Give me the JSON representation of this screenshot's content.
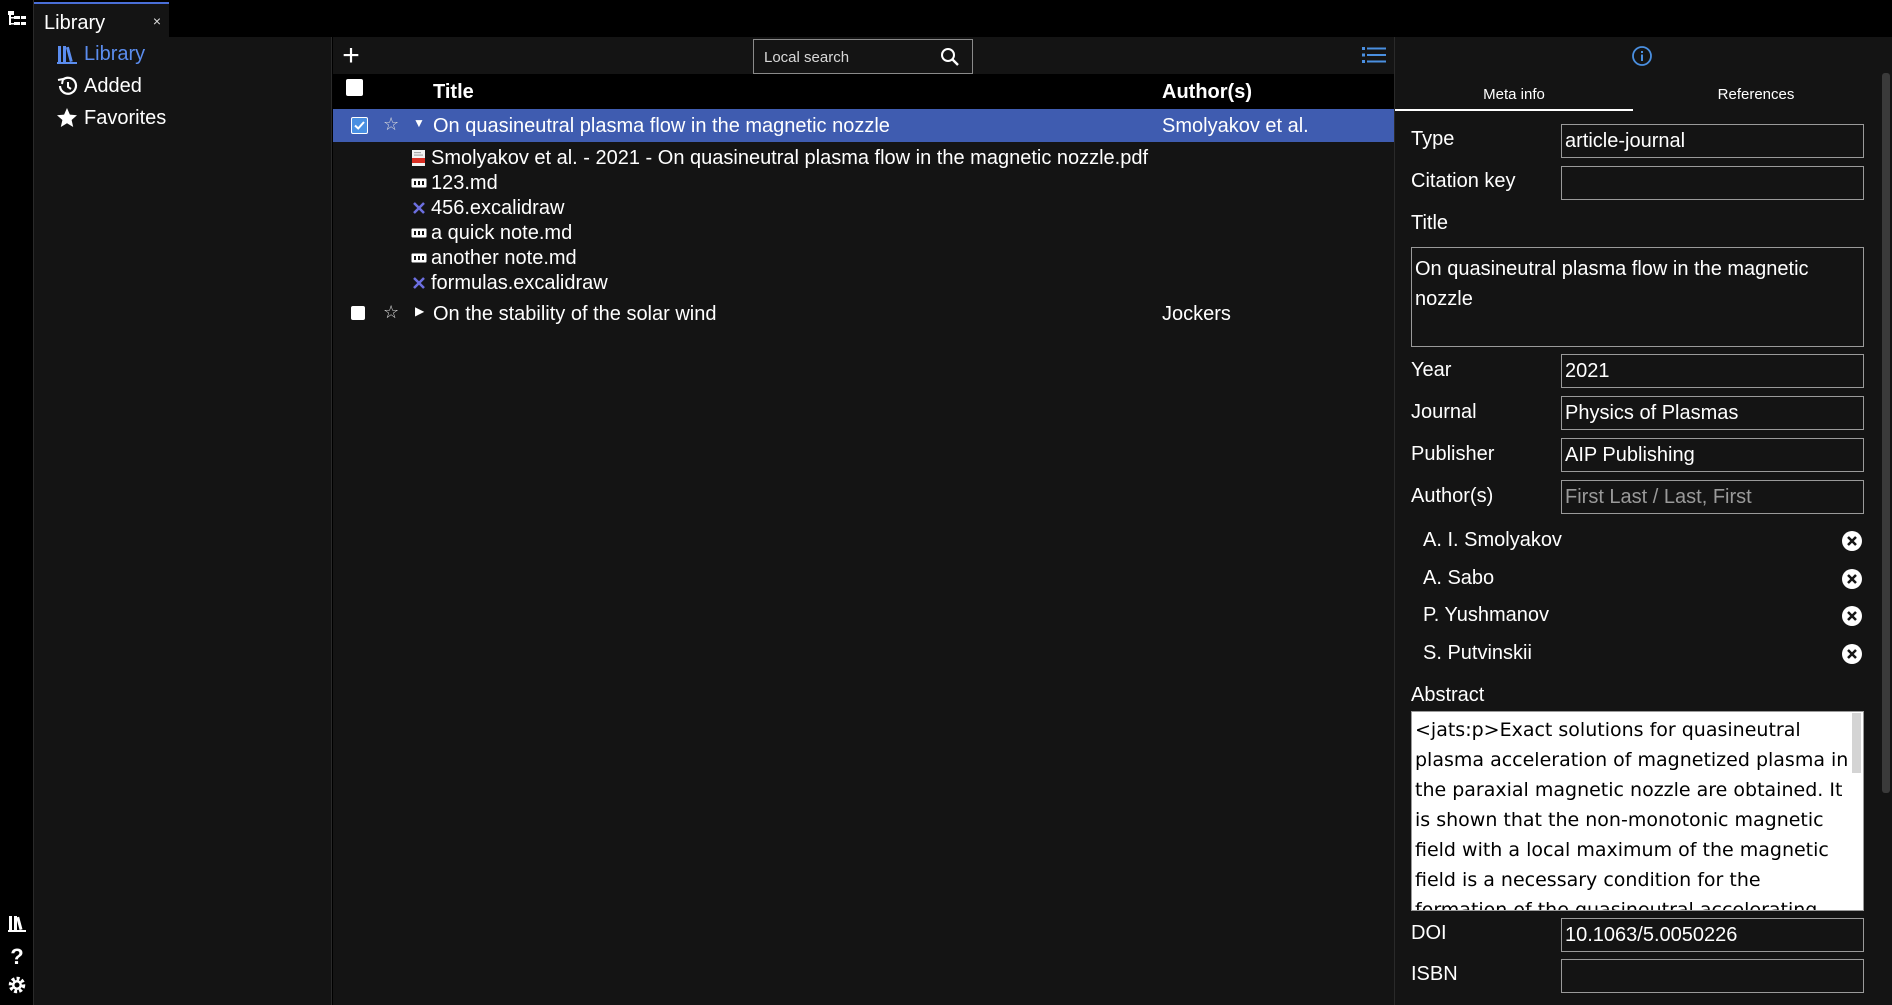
{
  "tab": {
    "label": "Library",
    "close": "×"
  },
  "sidebar": {
    "items": [
      {
        "label": "Library",
        "icon": "library-icon"
      },
      {
        "label": "Added",
        "icon": "history-icon"
      },
      {
        "label": "Favorites",
        "icon": "star-icon"
      }
    ]
  },
  "toolbar": {
    "add_label": "+",
    "search_placeholder": "Local search"
  },
  "table": {
    "headers": {
      "title": "Title",
      "authors": "Author(s)"
    },
    "rows": [
      {
        "title": "On quasineutral plasma flow in the magnetic nozzle",
        "authors": "Smolyakov et al.",
        "selected": true,
        "expanded": true,
        "star": "☆",
        "files": [
          {
            "name": "Smolyakov et al. - 2021 - On quasineutral plasma flow in the magnetic nozzle.pdf",
            "icon": "pdf-icon"
          },
          {
            "name": "123.md",
            "icon": "markdown-icon"
          },
          {
            "name": "456.excalidraw",
            "icon": "excalidraw-icon"
          },
          {
            "name": "a quick note.md",
            "icon": "markdown-icon"
          },
          {
            "name": "another note.md",
            "icon": "markdown-icon"
          },
          {
            "name": "formulas.excalidraw",
            "icon": "excalidraw-icon"
          }
        ]
      },
      {
        "title": "On the stability of the solar wind",
        "authors": "Jockers",
        "selected": false,
        "expanded": false,
        "star": "☆"
      }
    ]
  },
  "meta": {
    "tabs": [
      "Meta info",
      "References"
    ],
    "fields": {
      "type": {
        "label": "Type",
        "value": "article-journal"
      },
      "citation_key": {
        "label": "Citation key",
        "value": ""
      },
      "title": {
        "label": "Title",
        "value": "On quasineutral plasma flow in the magnetic nozzle"
      },
      "year": {
        "label": "Year",
        "value": "2021"
      },
      "journal": {
        "label": "Journal",
        "value": "Physics of Plasmas"
      },
      "publisher": {
        "label": "Publisher",
        "value": "AIP Publishing"
      },
      "authors": {
        "label": "Author(s)",
        "placeholder": "First Last / Last, First"
      },
      "abstract": {
        "label": "Abstract",
        "value": "<jats:p>Exact solutions for quasineutral plasma acceleration of magnetized plasma in the paraxial magnetic nozzle are obtained. It is shown that the non-monotonic magnetic field with a local maximum of the magnetic field is a necessary condition for the formation of the quasineutral accelerating potential structure. A"
      },
      "doi": {
        "label": "DOI",
        "value": "10.1063/5.0050226"
      },
      "isbn": {
        "label": "ISBN",
        "value": ""
      }
    },
    "author_list": [
      "A. I. Smolyakov",
      "A. Sabo",
      "P. Yushmanov",
      "S. Putvinskii"
    ]
  },
  "colors": {
    "accent": "#4a6fd8",
    "selection": "#3f5cb0",
    "active_nav": "#5b8def"
  }
}
